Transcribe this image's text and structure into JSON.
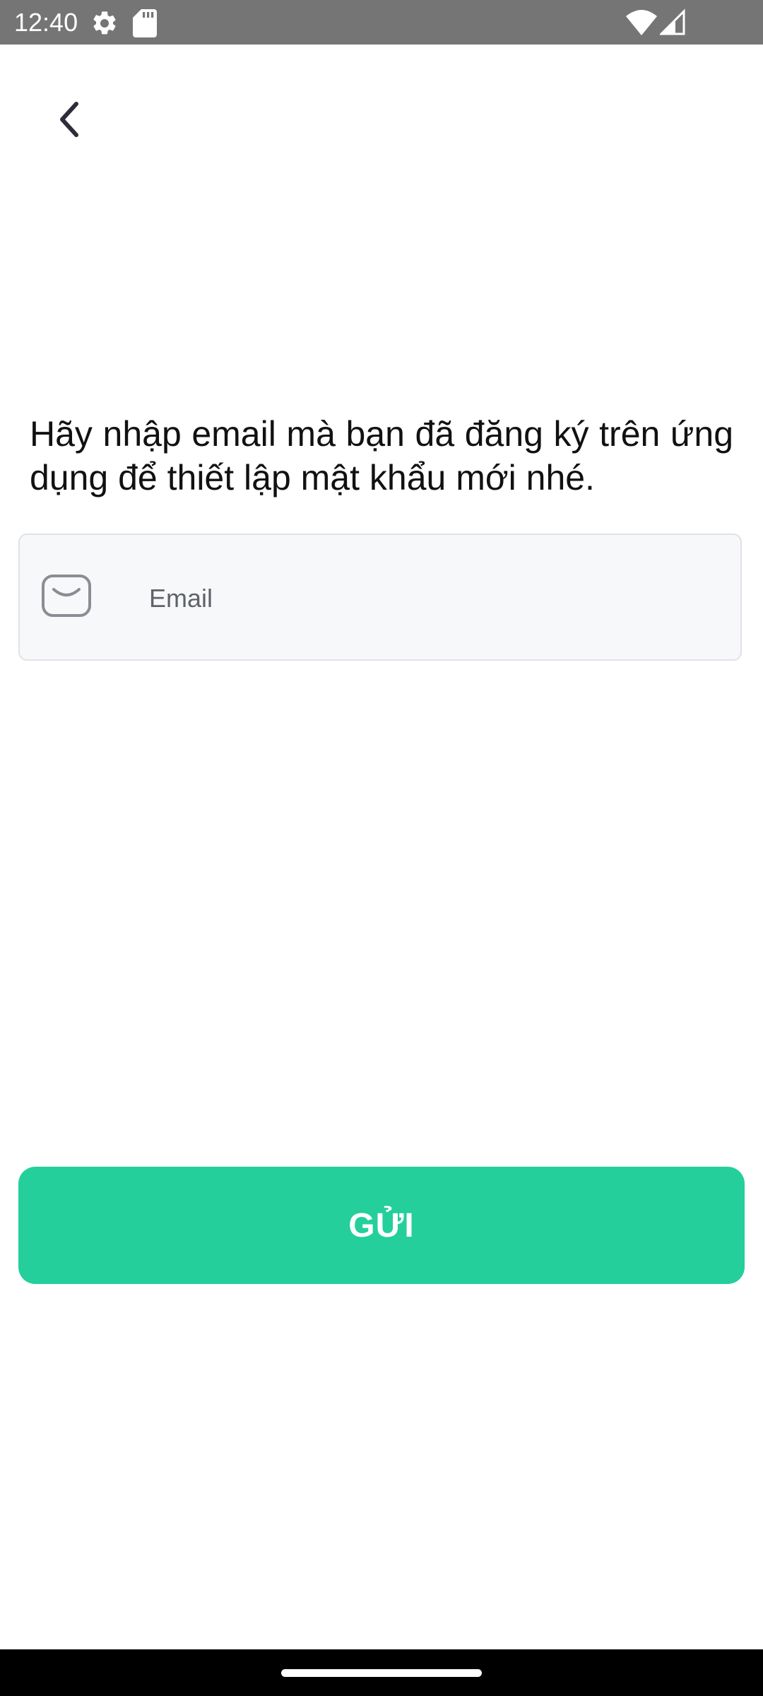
{
  "status_bar": {
    "time": "12:40",
    "icons": [
      "gear-icon",
      "sd-card-icon",
      "wifi-icon",
      "signal-icon"
    ]
  },
  "header": {
    "back_icon": "chevron-left-icon"
  },
  "main": {
    "instruction": "Hãy nhập email mà bạn đã đăng ký trên ứng dụng để thiết lập mật khẩu mới nhé.",
    "email_field": {
      "icon": "mail-icon",
      "placeholder": "Email",
      "value": ""
    },
    "submit_label": "GỬI"
  },
  "colors": {
    "accent": "#24cf9c",
    "status_bar": "#757575",
    "field_background": "#f7f8fa",
    "field_border": "#e0e2e6",
    "icon": "#2d2d3a"
  }
}
